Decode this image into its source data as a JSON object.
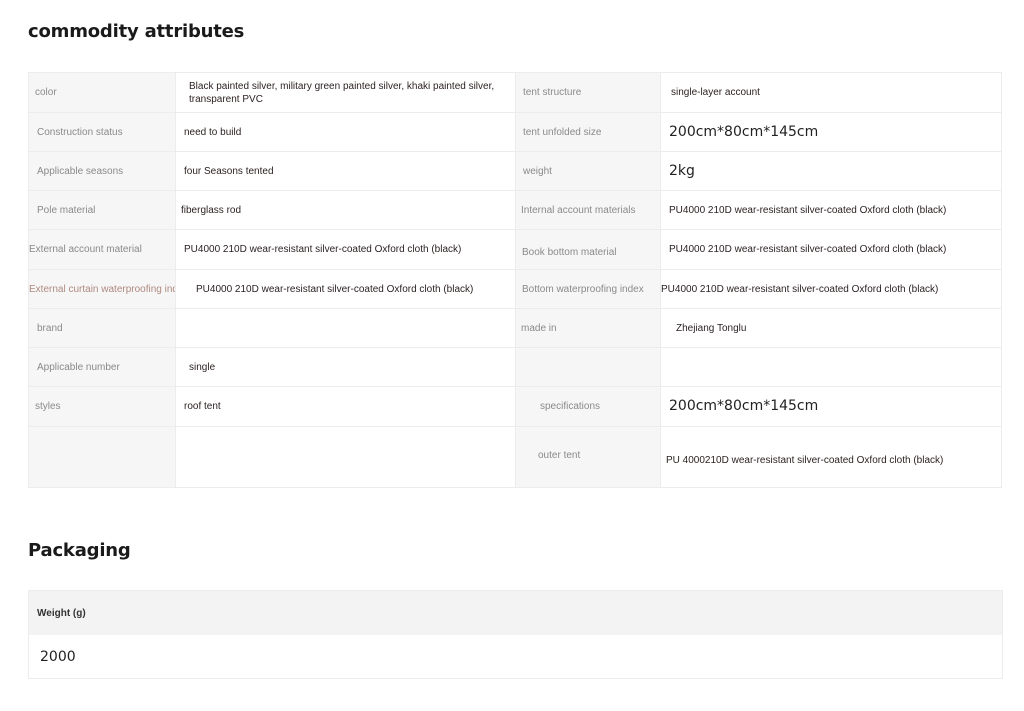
{
  "sections": {
    "attributes_title": "commodity attributes",
    "packaging_title": "Packaging"
  },
  "attributes": [
    [
      {
        "label": "color",
        "value": "Black painted silver, military green painted silver, khaki painted silver, transparent PVC"
      },
      {
        "label": "tent structure",
        "value": "single-layer account"
      }
    ],
    [
      {
        "label": "Construction status",
        "value": "need to build"
      },
      {
        "label": "tent unfolded size",
        "value": "200cm*80cm*145cm"
      }
    ],
    [
      {
        "label": "Applicable seasons",
        "value": "four Seasons tented"
      },
      {
        "label": "weight",
        "value": "2kg"
      }
    ],
    [
      {
        "label": "Pole material",
        "value": "fiberglass rod"
      },
      {
        "label": "Internal account materials",
        "value": "PU4000 210D wear-resistant silver-coated Oxford cloth (black)"
      }
    ],
    [
      {
        "label": "External account material",
        "value": "PU4000 210D wear-resistant silver-coated Oxford cloth (black)"
      },
      {
        "label": "Book bottom material",
        "value": "PU4000 210D wear-resistant silver-coated Oxford cloth (black)"
      }
    ],
    [
      {
        "label": "External curtain waterproofing index",
        "value": "PU4000 210D wear-resistant silver-coated Oxford cloth (black)"
      },
      {
        "label": "Bottom waterproofing index",
        "value": "PU4000 210D wear-resistant silver-coated Oxford cloth (black)"
      }
    ],
    [
      {
        "label": "brand",
        "value": ""
      },
      {
        "label": "made in",
        "value": "Zhejiang Tonglu"
      }
    ],
    [
      {
        "label": "Applicable number",
        "value": "single"
      },
      {
        "label": "",
        "value": ""
      }
    ],
    [
      {
        "label": "styles",
        "value": "roof tent"
      },
      {
        "label": "specifications",
        "value": "200cm*80cm*145cm"
      }
    ],
    [
      {
        "label": "",
        "value": ""
      },
      {
        "label": "outer tent",
        "value": "PU 4000210D wear-resistant silver-coated Oxford cloth (black)"
      }
    ]
  ],
  "packaging": {
    "header": "Weight (g)",
    "value": "2000"
  }
}
